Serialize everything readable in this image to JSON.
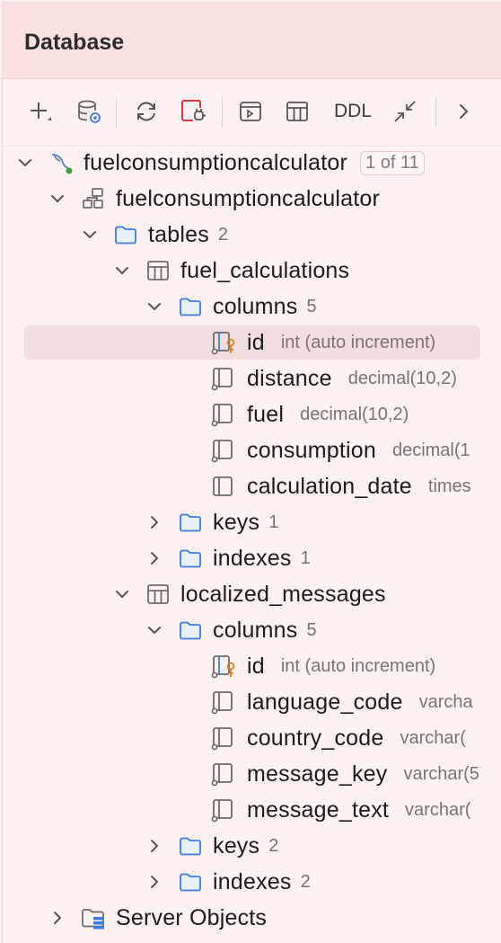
{
  "panel": {
    "title": "Database"
  },
  "toolbar": {
    "add": "plus-icon",
    "datasource": "datasource-settings-icon",
    "refresh": "refresh-icon",
    "disconnect": "disconnect-icon",
    "console": "console-icon",
    "table": "table-icon",
    "ddl_label": "DDL",
    "jump": "jump-to-source-icon",
    "more": "chevron-right-icon"
  },
  "tree": {
    "datasource": {
      "name": "fuelconsumptioncalculator",
      "badge": "1 of 11"
    },
    "schema": {
      "name": "fuelconsumptioncalculator"
    },
    "tables": {
      "name": "tables",
      "count": "2"
    },
    "table1": {
      "name": "fuel_calculations",
      "columns": {
        "name": "columns",
        "count": "5"
      },
      "cols": [
        {
          "name": "id",
          "type": "int (auto increment)"
        },
        {
          "name": "distance",
          "type": "decimal(10,2)"
        },
        {
          "name": "fuel",
          "type": "decimal(10,2)"
        },
        {
          "name": "consumption",
          "type": "decimal(1"
        },
        {
          "name": "calculation_date",
          "type": "times"
        }
      ],
      "keys": {
        "name": "keys",
        "count": "1"
      },
      "indexes": {
        "name": "indexes",
        "count": "1"
      }
    },
    "table2": {
      "name": "localized_messages",
      "columns": {
        "name": "columns",
        "count": "5"
      },
      "cols": [
        {
          "name": "id",
          "type": "int (auto increment)"
        },
        {
          "name": "language_code",
          "type": "varcha"
        },
        {
          "name": "country_code",
          "type": "varchar("
        },
        {
          "name": "message_key",
          "type": "varchar(5"
        },
        {
          "name": "message_text",
          "type": "varchar("
        }
      ],
      "keys": {
        "name": "keys",
        "count": "2"
      },
      "indexes": {
        "name": "indexes",
        "count": "2"
      }
    },
    "server_objects": {
      "name": "Server Objects"
    }
  }
}
